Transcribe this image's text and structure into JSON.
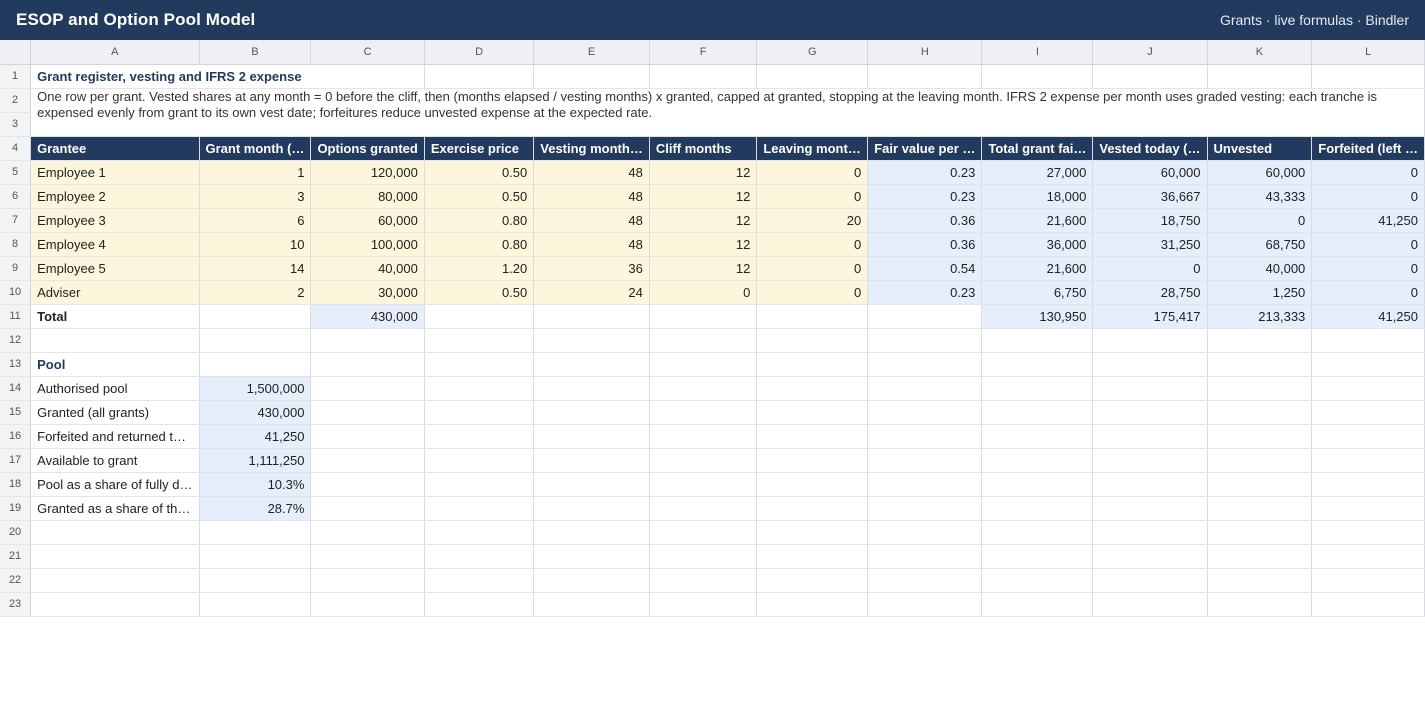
{
  "app": {
    "title": "ESOP and Option Pool Model",
    "meta": "Grants · live formulas · Bindler"
  },
  "columns": [
    "A",
    "B",
    "C",
    "D",
    "E",
    "F",
    "G",
    "H",
    "I",
    "J",
    "K",
    "L"
  ],
  "sheet_title": "Grant register, vesting and IFRS 2 expense",
  "note": "One row per grant. Vested shares at any month = 0 before the cliff, then (months elapsed / vesting months) x granted, capped at granted, stopping at the leaving month. IFRS 2 expense per month uses graded vesting: each tranche is expensed evenly from grant to its own vest date; forfeitures reduce unvested expense at the expected rate.",
  "headers": [
    "Grantee",
    "Grant month (…",
    "Options granted",
    "Exercise price",
    "Vesting month…",
    "Cliff months",
    "Leaving mont…",
    "Fair value per …",
    "Total grant fai…",
    "Vested today (…",
    "Unvested",
    "Forfeited (left …"
  ],
  "grants": [
    {
      "grantee": "Employee 1",
      "grant_month": "1",
      "options": "120,000",
      "price": "0.50",
      "vesting": "48",
      "cliff": "12",
      "leaving": "0",
      "fair_value": "0.23",
      "total_fv": "27,000",
      "vested": "60,000",
      "unvested": "60,000",
      "forfeited": "0"
    },
    {
      "grantee": "Employee 2",
      "grant_month": "3",
      "options": "80,000",
      "price": "0.50",
      "vesting": "48",
      "cliff": "12",
      "leaving": "0",
      "fair_value": "0.23",
      "total_fv": "18,000",
      "vested": "36,667",
      "unvested": "43,333",
      "forfeited": "0"
    },
    {
      "grantee": "Employee 3",
      "grant_month": "6",
      "options": "60,000",
      "price": "0.80",
      "vesting": "48",
      "cliff": "12",
      "leaving": "20",
      "fair_value": "0.36",
      "total_fv": "21,600",
      "vested": "18,750",
      "unvested": "0",
      "forfeited": "41,250"
    },
    {
      "grantee": "Employee 4",
      "grant_month": "10",
      "options": "100,000",
      "price": "0.80",
      "vesting": "48",
      "cliff": "12",
      "leaving": "0",
      "fair_value": "0.36",
      "total_fv": "36,000",
      "vested": "31,250",
      "unvested": "68,750",
      "forfeited": "0"
    },
    {
      "grantee": "Employee 5",
      "grant_month": "14",
      "options": "40,000",
      "price": "1.20",
      "vesting": "36",
      "cliff": "12",
      "leaving": "0",
      "fair_value": "0.54",
      "total_fv": "21,600",
      "vested": "0",
      "unvested": "40,000",
      "forfeited": "0"
    },
    {
      "grantee": "Adviser",
      "grant_month": "2",
      "options": "30,000",
      "price": "0.50",
      "vesting": "24",
      "cliff": "0",
      "leaving": "0",
      "fair_value": "0.23",
      "total_fv": "6,750",
      "vested": "28,750",
      "unvested": "1,250",
      "forfeited": "0"
    }
  ],
  "total": {
    "label": "Total",
    "options": "430,000",
    "total_fv": "130,950",
    "vested": "175,417",
    "unvested": "213,333",
    "forfeited": "41,250"
  },
  "pool": {
    "title": "Pool",
    "rows": [
      {
        "label": "Authorised pool",
        "value": "1,500,000"
      },
      {
        "label": "Granted (all grants)",
        "value": "430,000"
      },
      {
        "label": "Forfeited and returned t…",
        "value": "41,250"
      },
      {
        "label": "Available to grant",
        "value": "1,111,250"
      },
      {
        "label": "Pool as a share of fully d…",
        "value": "10.3%"
      },
      {
        "label": "Granted as a share of th…",
        "value": "28.7%"
      }
    ]
  },
  "row_numbers": [
    "1",
    "2",
    "3",
    "4",
    "5",
    "6",
    "7",
    "8",
    "9",
    "10",
    "11",
    "12",
    "13",
    "14",
    "15",
    "16",
    "17",
    "18",
    "19",
    "20",
    "21",
    "22",
    "23"
  ]
}
